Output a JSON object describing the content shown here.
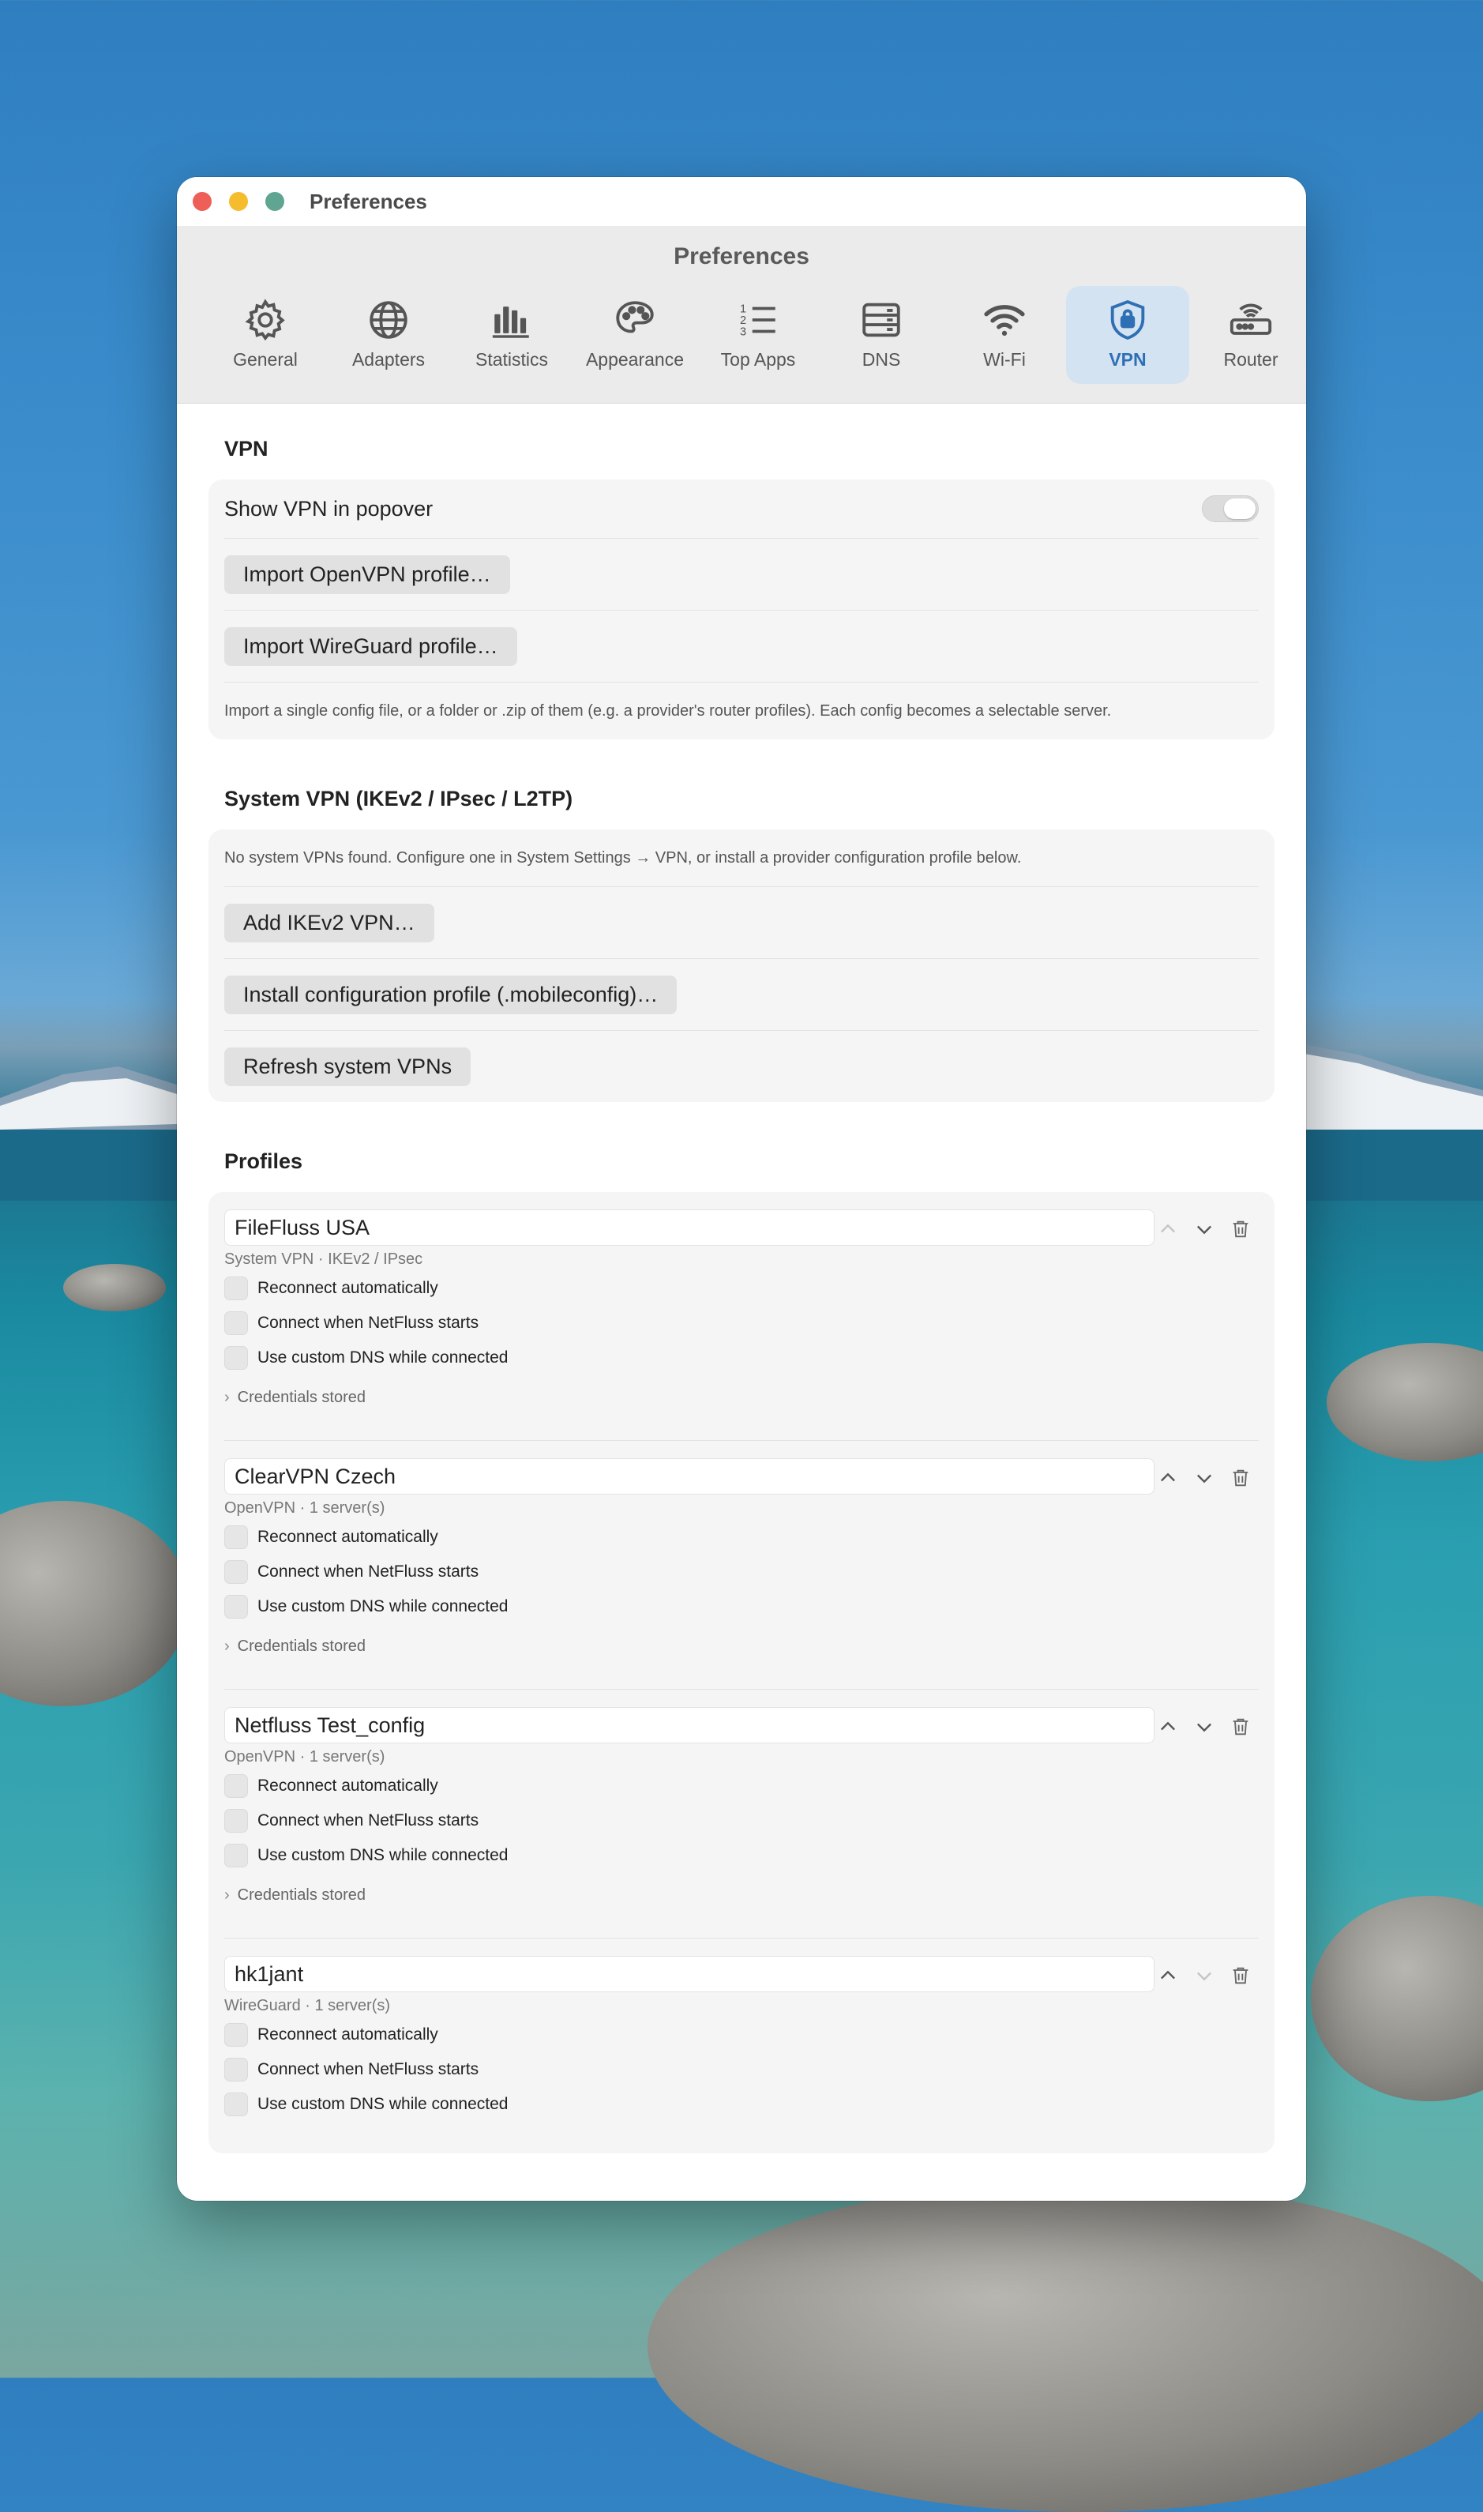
{
  "window": {
    "title": "Preferences"
  },
  "toolbar": {
    "title": "Preferences",
    "tabs": [
      {
        "label": "General",
        "icon": "gear-icon"
      },
      {
        "label": "Adapters",
        "icon": "globe-icon"
      },
      {
        "label": "Statistics",
        "icon": "bar-chart-icon"
      },
      {
        "label": "Appearance",
        "icon": "palette-icon"
      },
      {
        "label": "Top Apps",
        "icon": "numbered-list-icon"
      },
      {
        "label": "DNS",
        "icon": "server-icon"
      },
      {
        "label": "Wi-Fi",
        "icon": "wifi-icon"
      },
      {
        "label": "VPN",
        "icon": "shield-lock-icon",
        "active": true
      },
      {
        "label": "Router",
        "icon": "router-icon"
      }
    ]
  },
  "vpn": {
    "title": "VPN",
    "show_label": "Show VPN in popover",
    "show_enabled": false,
    "import_openvpn": "Import OpenVPN profile…",
    "import_wireguard": "Import WireGuard profile…",
    "hint": "Import a single config file, or a folder or .zip of them (e.g. a provider's router profiles). Each config becomes a selectable server."
  },
  "system_vpn": {
    "title": "System VPN (IKEv2 / IPsec / L2TP)",
    "hint": "No system VPNs found. Configure one in System Settings → VPN, or install a provider configuration profile below.",
    "add_ikev2": "Add IKEv2 VPN…",
    "install_profile": "Install configuration profile (.mobileconfig)…",
    "refresh": "Refresh system VPNs"
  },
  "profiles": {
    "title": "Profiles",
    "option_labels": {
      "reconnect": "Reconnect automatically",
      "connect_on_start": "Connect when NetFluss starts",
      "custom_dns": "Use custom DNS while connected"
    },
    "items": [
      {
        "name": "FileFluss USA",
        "type": "System VPN · IKEv2 / IPsec",
        "credentials": "Credentials stored"
      },
      {
        "name": "ClearVPN Czech",
        "type": "OpenVPN · 1 server(s)",
        "credentials": "Credentials stored"
      },
      {
        "name": "Netfluss Test_config",
        "type": "OpenVPN · 1 server(s)",
        "credentials": "Credentials stored"
      },
      {
        "name": "hk1jant",
        "type": "WireGuard · 1 server(s)"
      }
    ]
  },
  "colors": {
    "accent": "#2e6fb5",
    "active_tab_bg": "#d4e3f1"
  }
}
